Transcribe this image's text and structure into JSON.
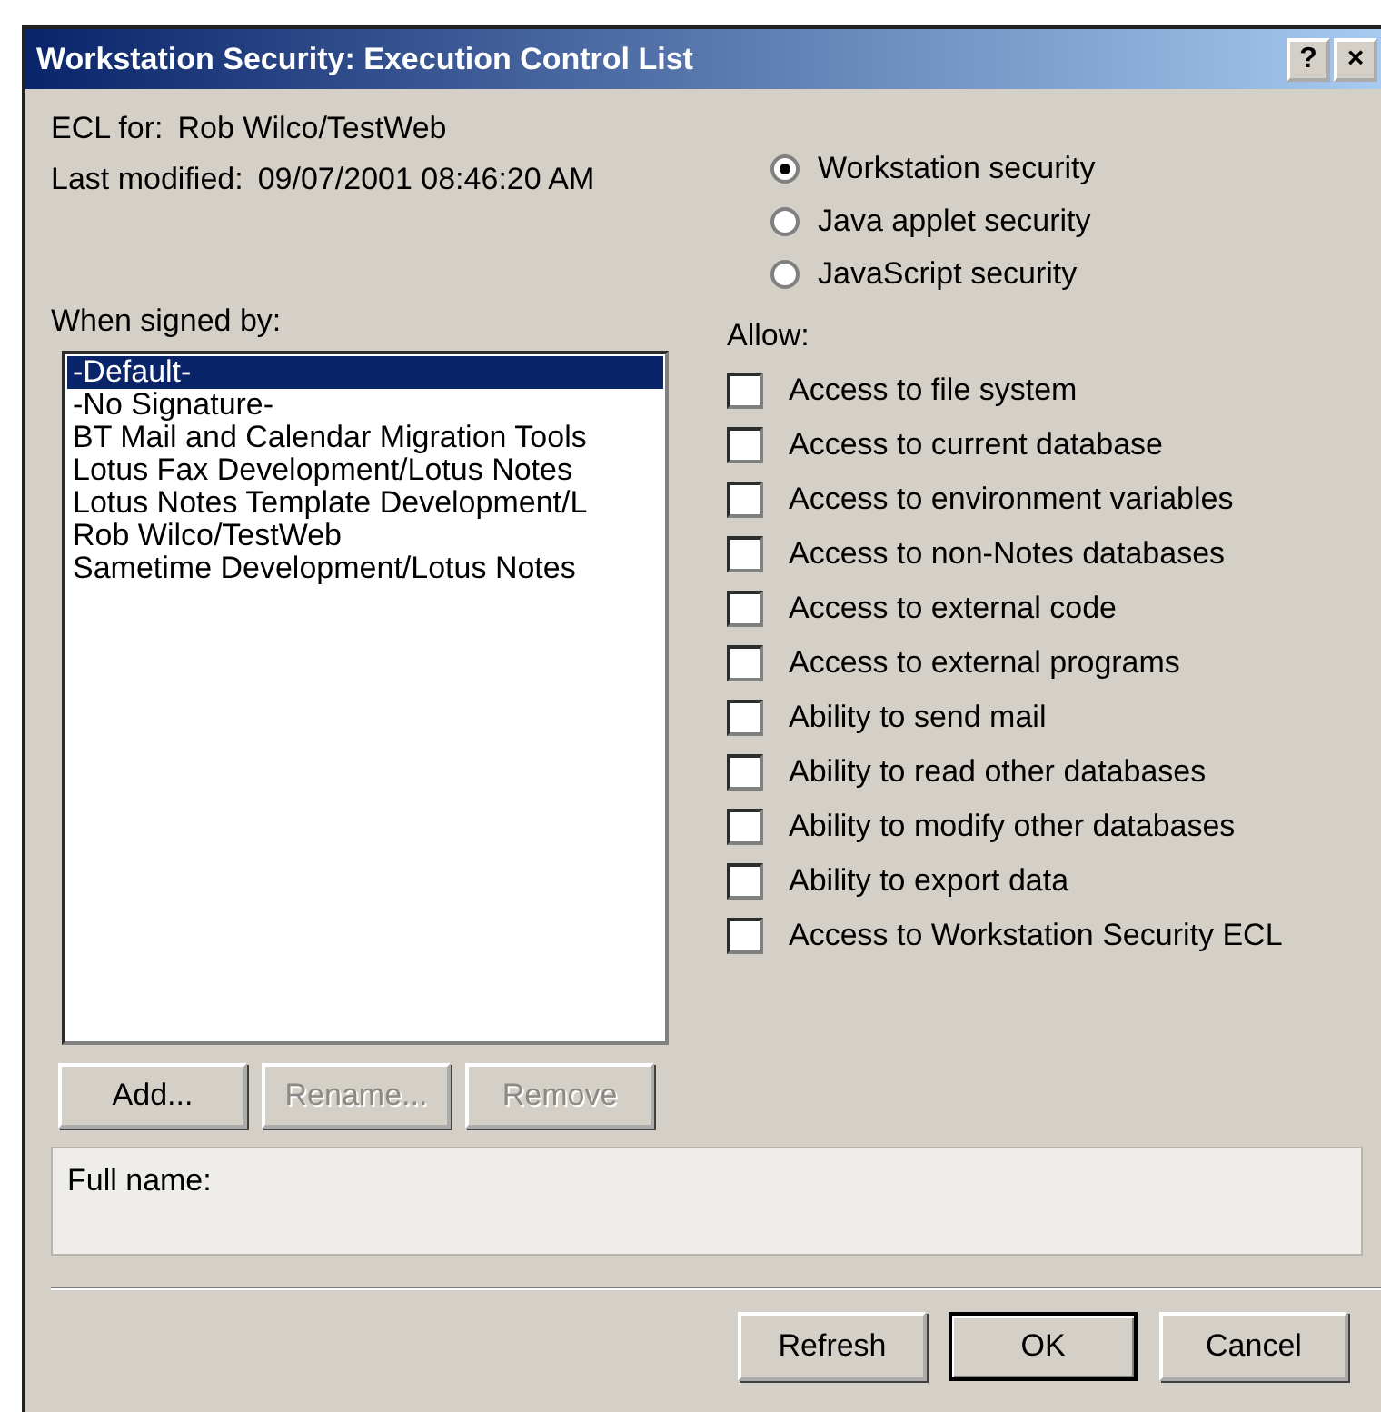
{
  "window": {
    "title": "Workstation Security:  Execution Control List",
    "controls": [
      "?",
      "×"
    ]
  },
  "ecl_for": {
    "label": "ECL for:",
    "value": "Rob Wilco/TestWeb"
  },
  "last_modified": {
    "label": "Last modified:",
    "value": "09/07/2001 08:46:20 AM"
  },
  "security_types": [
    {
      "label": "Workstation security",
      "selected": true
    },
    {
      "label": "Java applet security",
      "selected": false
    },
    {
      "label": "JavaScript security",
      "selected": false
    }
  ],
  "signers": {
    "label": "When signed by:",
    "items": [
      {
        "label": "-Default-",
        "selected": true
      },
      {
        "label": "-No Signature-",
        "selected": false
      },
      {
        "label": "BT Mail and Calendar Migration Tools",
        "selected": false
      },
      {
        "label": "Lotus Fax Development/Lotus Notes",
        "selected": false
      },
      {
        "label": "Lotus Notes Template Development/L",
        "selected": false
      },
      {
        "label": "Rob Wilco/TestWeb",
        "selected": false
      },
      {
        "label": "Sametime Development/Lotus Notes",
        "selected": false
      }
    ]
  },
  "list_buttons": [
    {
      "label": "Add...",
      "disabled": false
    },
    {
      "label": "Rename...",
      "disabled": true
    },
    {
      "label": "Remove",
      "disabled": true
    }
  ],
  "allow": {
    "label": "Allow:",
    "items": [
      {
        "label": "Access to file system",
        "checked": false
      },
      {
        "label": "Access to current database",
        "checked": false
      },
      {
        "label": "Access to environment variables",
        "checked": false
      },
      {
        "label": "Access to non-Notes databases",
        "checked": false
      },
      {
        "label": "Access to external code",
        "checked": false
      },
      {
        "label": "Access to external programs",
        "checked": false
      },
      {
        "label": "Ability to send mail",
        "checked": false
      },
      {
        "label": "Ability to read other databases",
        "checked": false
      },
      {
        "label": "Ability to modify other databases",
        "checked": false
      },
      {
        "label": "Ability to export data",
        "checked": false
      },
      {
        "label": "Access to Workstation Security ECL",
        "checked": false
      }
    ]
  },
  "full_name": {
    "label": "Full name:"
  },
  "dialog_buttons": [
    {
      "label": "Refresh",
      "default": false
    },
    {
      "label": "OK",
      "default": true
    },
    {
      "label": "Cancel",
      "default": false
    }
  ]
}
